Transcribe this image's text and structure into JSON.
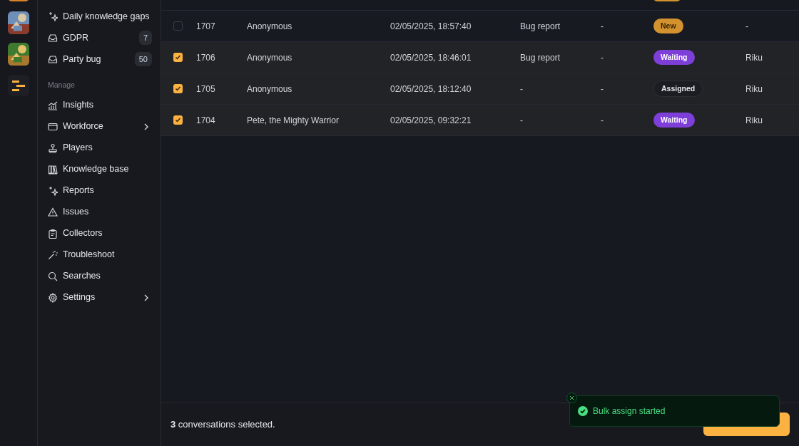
{
  "sidebar": {
    "top_items": [
      {
        "label": "Daily knowledge gaps"
      },
      {
        "label": "GDPR",
        "count": "7"
      },
      {
        "label": "Party bug",
        "count": "50"
      }
    ],
    "section_title": "Manage",
    "items": [
      {
        "label": "Insights",
        "submenu": false
      },
      {
        "label": "Workforce",
        "submenu": true
      },
      {
        "label": "Players",
        "submenu": false
      },
      {
        "label": "Knowledge base",
        "submenu": false
      },
      {
        "label": "Reports",
        "submenu": false
      },
      {
        "label": "Issues",
        "submenu": false
      },
      {
        "label": "Collectors",
        "submenu": false
      },
      {
        "label": "Troubleshoot",
        "submenu": false
      },
      {
        "label": "Searches",
        "submenu": false
      },
      {
        "label": "Settings",
        "submenu": true
      }
    ]
  },
  "table": {
    "rows": [
      {
        "selected": false,
        "id": "1707",
        "name": "Anonymous",
        "date": "02/05/2025, 18:57:40",
        "type": "Bug report",
        "column_5": "-",
        "status": {
          "label": "New",
          "kind": "new"
        },
        "assignee": "-"
      },
      {
        "selected": true,
        "id": "1706",
        "name": "Anonymous",
        "date": "02/05/2025, 18:46:01",
        "type": "Bug report",
        "column_5": "-",
        "status": {
          "label": "Waiting",
          "kind": "waiting"
        },
        "assignee": "Riku"
      },
      {
        "selected": true,
        "id": "1705",
        "name": "Anonymous",
        "date": "02/05/2025, 18:12:40",
        "type": "-",
        "column_5": "-",
        "status": {
          "label": "Assigned",
          "kind": "assigned"
        },
        "assignee": "Riku"
      },
      {
        "selected": true,
        "id": "1704",
        "name": "Pete, the Mighty Warrior",
        "date": "02/05/2025, 09:32:21",
        "type": "-",
        "column_5": "-",
        "status": {
          "label": "Waiting",
          "kind": "waiting"
        },
        "assignee": "Riku"
      }
    ]
  },
  "footer": {
    "selection_text": "**3** conversations selected."
  },
  "toast": {
    "message": "Bulk assign started"
  }
}
